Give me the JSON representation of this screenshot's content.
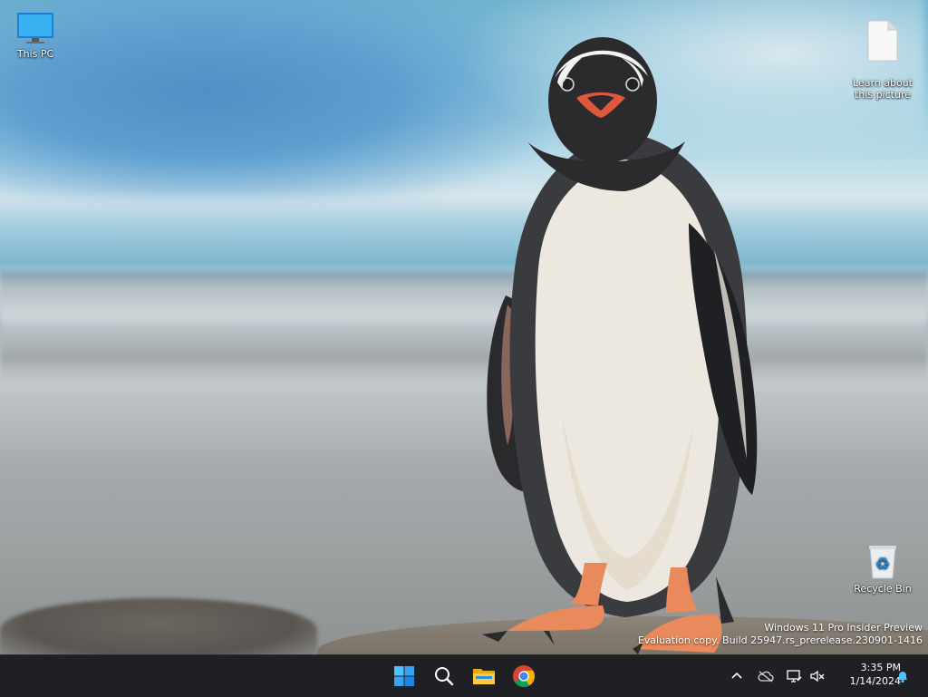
{
  "desktop": {
    "icons": [
      {
        "label": "This PC",
        "icon": "monitor-icon"
      },
      {
        "label": "Learn about\nthis picture",
        "icon": "document-icon"
      },
      {
        "label": "Recycle Bin",
        "icon": "recycle-bin-icon"
      }
    ],
    "watermark": {
      "line1": "Windows 11 Pro Insider Preview",
      "line2": "Evaluation copy. Build 25947.rs_prerelease.230901-1416"
    }
  },
  "taskbar": {
    "apps": [
      {
        "name": "Start",
        "icon": "windows-logo-icon"
      },
      {
        "name": "Search",
        "icon": "search-icon"
      },
      {
        "name": "File Explorer",
        "icon": "folder-icon"
      },
      {
        "name": "Google Chrome",
        "icon": "chrome-icon"
      }
    ],
    "tray": {
      "icons": [
        "chevron-up-icon",
        "cloud-offline-icon",
        "network-icon",
        "volume-muted-icon",
        "notification-bell-icon"
      ],
      "time": "3:35 PM",
      "date": "1/14/2024"
    }
  },
  "colors": {
    "taskbar_bg": "#1f2023",
    "accent": "#3aa0f0"
  }
}
